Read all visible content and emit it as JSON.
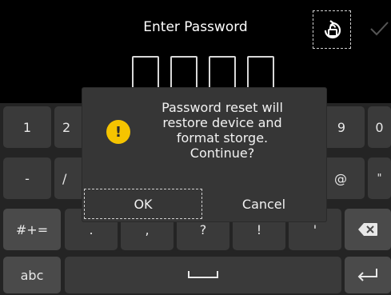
{
  "header": {
    "title": "Enter Password"
  },
  "icons": {
    "unlock": "unlock-rotate-icon",
    "confirm": "checkmark-icon",
    "warning": "exclamation-icon",
    "backspace": "backspace-icon",
    "enter": "enter-icon",
    "space": "space-bar-icon"
  },
  "colors": {
    "warning": "#f5c400",
    "background": "#000000",
    "keyboard": "#242424",
    "dialog": "#363636"
  },
  "keyboard": {
    "row1": [
      "1",
      "2",
      "9",
      "0"
    ],
    "row2": [
      "-",
      "/",
      "@",
      "\""
    ],
    "row3": [
      "#+=",
      ".",
      ",",
      "?",
      "!",
      "'"
    ],
    "row4": [
      "abc"
    ]
  },
  "dialog": {
    "message_lines": [
      "Password reset will",
      "restore device and",
      "format storge.",
      "Continue?"
    ],
    "ok_label": "OK",
    "cancel_label": "Cancel"
  }
}
